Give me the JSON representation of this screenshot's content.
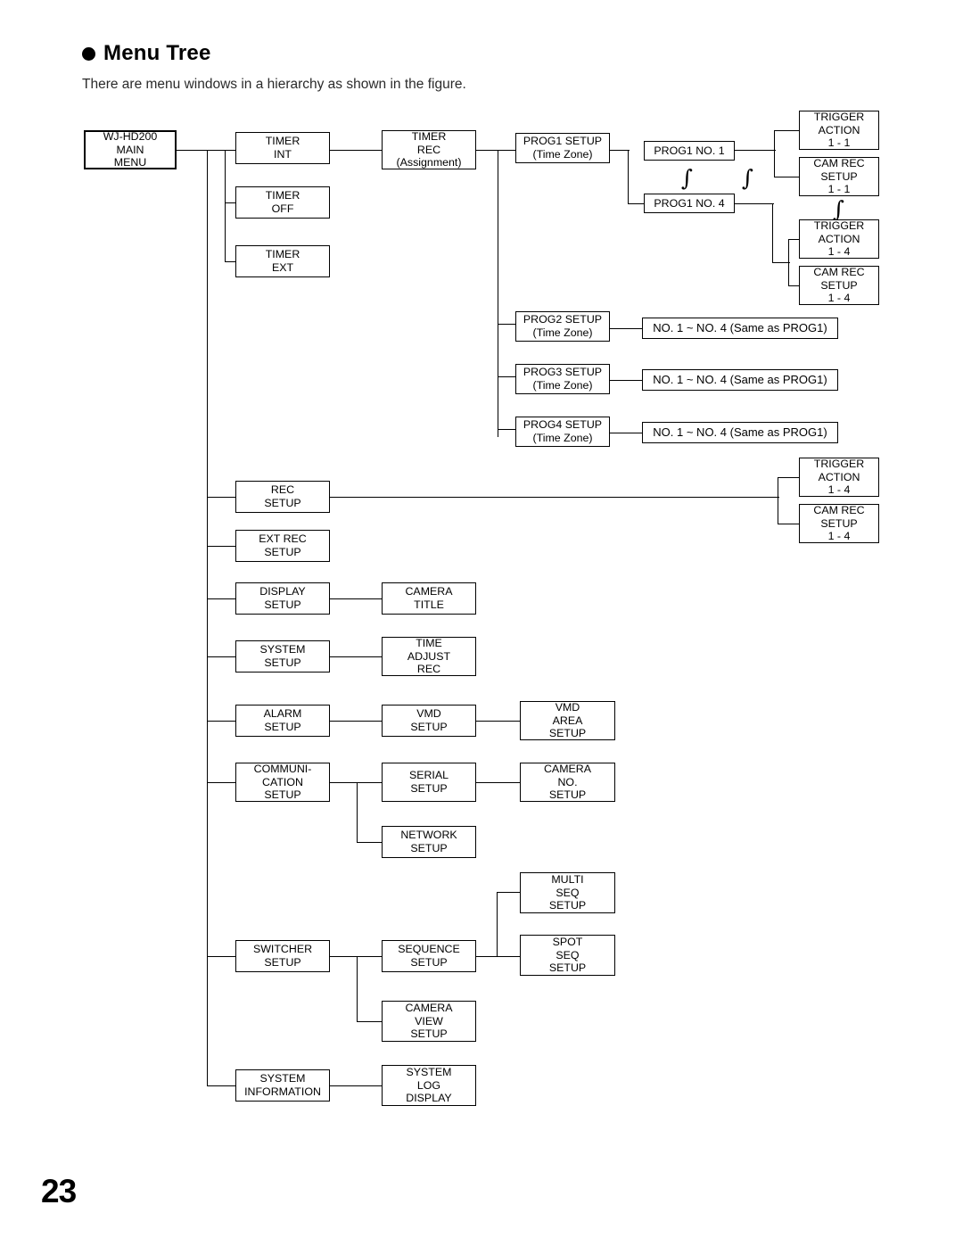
{
  "document": {
    "bullet_icon": "filled-circle",
    "heading": "Menu Tree",
    "subtitle": "There are menu windows in a hierarchy as shown in the figure.",
    "page_number": "23"
  },
  "diagram": {
    "squiggle_glyph": "∫",
    "nodes": {
      "main_menu": [
        "WJ-HD200",
        "MAIN",
        "MENU"
      ],
      "timer_int": [
        "TIMER",
        "INT"
      ],
      "timer_off": [
        "TIMER",
        "OFF"
      ],
      "timer_ext": [
        "TIMER",
        "EXT"
      ],
      "timer_rec": [
        "TIMER",
        "REC",
        "(Assignment)"
      ],
      "prog1_setup": [
        "PROG1 SETUP",
        "(Time Zone)"
      ],
      "prog1_no1": [
        "PROG1 NO. 1"
      ],
      "prog1_no4": [
        "PROG1 NO. 4"
      ],
      "trigger_action_1_1": [
        "TRIGGER",
        "ACTION",
        "1 - 1"
      ],
      "cam_rec_setup_1_1": [
        "CAM REC",
        "SETUP",
        "1 - 1"
      ],
      "trigger_action_1_4": [
        "TRIGGER",
        "ACTION",
        "1 - 4"
      ],
      "cam_rec_setup_1_4": [
        "CAM REC",
        "SETUP",
        "1 - 4"
      ],
      "prog2_setup": [
        "PROG2 SETUP",
        "(Time Zone)"
      ],
      "prog3_setup": [
        "PROG3 SETUP",
        "(Time Zone)"
      ],
      "prog4_setup": [
        "PROG4 SETUP",
        "(Time Zone)"
      ],
      "prog2_range": [
        "NO. 1 ~ NO. 4 (Same as PROG1)"
      ],
      "prog3_range": [
        "NO. 1 ~ NO. 4 (Same as PROG1)"
      ],
      "prog4_range": [
        "NO. 1 ~ NO. 4 (Same as PROG1)"
      ],
      "rec_setup": [
        "REC",
        "SETUP"
      ],
      "rec_trigger_action": [
        "TRIGGER",
        "ACTION",
        "1 - 4"
      ],
      "rec_cam_rec_setup": [
        "CAM REC",
        "SETUP",
        "1 - 4"
      ],
      "ext_rec_setup": [
        "EXT REC",
        "SETUP"
      ],
      "display_setup": [
        "DISPLAY",
        "SETUP"
      ],
      "camera_title": [
        "CAMERA",
        "TITLE"
      ],
      "system_setup": [
        "SYSTEM",
        "SETUP"
      ],
      "time_adjust_rec": [
        "TIME",
        "ADJUST",
        "REC"
      ],
      "alarm_setup": [
        "ALARM",
        "SETUP"
      ],
      "vmd_setup": [
        "VMD",
        "SETUP"
      ],
      "vmd_area_setup": [
        "VMD",
        "AREA",
        "SETUP"
      ],
      "communication_setup": [
        "COMMUNI-",
        "CATION",
        "SETUP"
      ],
      "serial_setup": [
        "SERIAL",
        "SETUP"
      ],
      "camera_no_setup": [
        "CAMERA",
        "NO.",
        "SETUP"
      ],
      "network_setup": [
        "NETWORK",
        "SETUP"
      ],
      "switcher_setup": [
        "SWITCHER",
        "SETUP"
      ],
      "sequence_setup": [
        "SEQUENCE",
        "SETUP"
      ],
      "multi_seq_setup": [
        "MULTI",
        "SEQ",
        "SETUP"
      ],
      "spot_seq_setup": [
        "SPOT",
        "SEQ",
        "SETUP"
      ],
      "camera_view_setup": [
        "CAMERA",
        "VIEW",
        "SETUP"
      ],
      "system_information": [
        "SYSTEM",
        "INFORMATION"
      ],
      "system_log_display": [
        "SYSTEM",
        "LOG",
        "DISPLAY"
      ]
    }
  }
}
